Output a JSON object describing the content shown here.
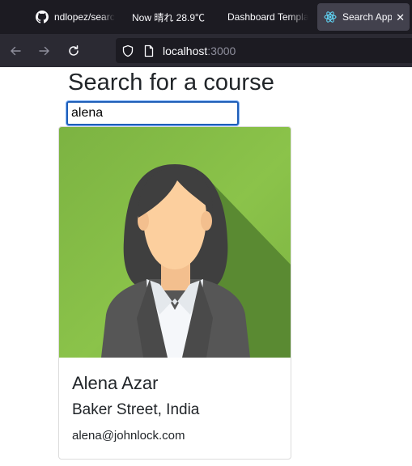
{
  "browser": {
    "tabs": [
      {
        "label": "ndlopez/searc",
        "icon": "github-icon"
      },
      {
        "label": "Now 晴れ 28.9℃",
        "icon": "none"
      },
      {
        "label": "Dashboard Templa",
        "icon": "none"
      },
      {
        "label": "Search App",
        "icon": "react-icon",
        "active": true
      }
    ],
    "url_host": "localhost",
    "url_port": ":3000"
  },
  "page": {
    "title": "Search for a course",
    "search_value": "alena"
  },
  "results": [
    {
      "name": "Alena Azar",
      "address": "Baker Street, India",
      "email": "alena@johnlock.com",
      "avatar": "female-avatar-illustration"
    }
  ],
  "colors": {
    "tabbar_bg": "#1c1b22",
    "navbar_bg": "#2b2a33",
    "input_focus": "#1e5eb8",
    "avatar_bg": "#8bc34a"
  }
}
